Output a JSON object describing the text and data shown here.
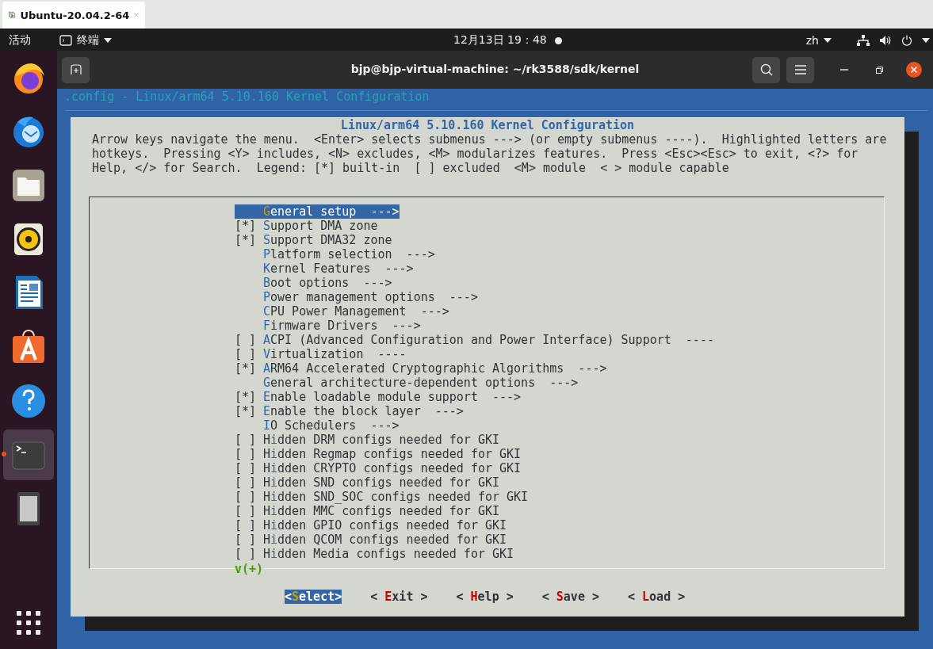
{
  "vm_tab": {
    "title": "Ubuntu-20.04.2-64",
    "selected": true
  },
  "top_bar": {
    "activities": "活动",
    "app_menu": "终端",
    "clock": "12月13日 19：48",
    "input_method": "zh"
  },
  "dock": [
    {
      "kind": "browser",
      "active": false
    },
    {
      "kind": "mail",
      "active": false
    },
    {
      "kind": "files",
      "active": false
    },
    {
      "kind": "music",
      "active": false
    },
    {
      "kind": "writer",
      "active": false
    },
    {
      "kind": "software",
      "active": false
    },
    {
      "kind": "help",
      "active": false
    },
    {
      "kind": "terminal",
      "active": true
    },
    {
      "kind": "phone",
      "active": false
    }
  ],
  "terminal": {
    "title": "bjp@bjp-virtual-machine: ~/rk3588/sdk/kernel",
    "screen_title": ".config - Linux/arm64 5.10.160 Kernel Configuration",
    "dialog": {
      "title": "Linux/arm64 5.10.160 Kernel Configuration",
      "help": "Arrow keys navigate the menu.  <Enter> selects submenus ---> (or empty submenus ----).  Highlighted letters are\nhotkeys.  Pressing <Y> includes, <N> excludes, <M> modularizes features.  Press <Esc><Esc> to exit, <?> for\nHelp, </> for Search.  Legend: [*] built-in  [ ] excluded  <M> module  < > module capable",
      "items": [
        {
          "hotkey": "G",
          "after": "eneral setup  --->",
          "selected": true
        },
        {
          "box": "[*]",
          "hotkey": "S",
          "after": "upport DMA zone",
          "selected": false
        },
        {
          "box": "[*]",
          "hotkey": "S",
          "after": "upport DMA32 zone",
          "selected": false
        },
        {
          "hotkey": "P",
          "after": "latform selection  --->",
          "selected": false
        },
        {
          "hotkey": "K",
          "after": "ernel Features  --->",
          "selected": false
        },
        {
          "hotkey": "B",
          "after": "oot options  --->",
          "selected": false
        },
        {
          "hotkey": "P",
          "after": "ower management options  --->",
          "selected": false
        },
        {
          "hotkey": "C",
          "after": "PU Power Management  --->",
          "selected": false
        },
        {
          "hotkey": "F",
          "after": "irmware Drivers  --->",
          "selected": false
        },
        {
          "box": "[ ]",
          "hotkey": "A",
          "after": "CPI (Advanced Configuration and Power Interface) Support  ----",
          "selected": false
        },
        {
          "box": "[ ]",
          "hotkey": "V",
          "after": "irtualization  ----",
          "selected": false
        },
        {
          "box": "[*]",
          "hotkey": "A",
          "after": "RM64 Accelerated Cryptographic Algorithms  --->",
          "selected": false
        },
        {
          "hotkey": "G",
          "after": "eneral architecture-dependent options  --->",
          "selected": false
        },
        {
          "box": "[*]",
          "hotkey": "E",
          "after": "nable loadable module support  --->",
          "selected": false
        },
        {
          "box": "[*]",
          "hotkey": "E",
          "after": "nable the block layer  --->",
          "selected": false
        },
        {
          "hotkey": "I",
          "after": "O Schedulers  --->",
          "selected": false
        },
        {
          "box": "[ ]",
          "before": "H",
          "hotkey": "i",
          "after": "dden DRM configs needed for GKI",
          "selected": false
        },
        {
          "box": "[ ]",
          "before": "H",
          "hotkey": "i",
          "after": "dden Regmap configs needed for GKI",
          "selected": false
        },
        {
          "box": "[ ]",
          "before": "H",
          "hotkey": "i",
          "after": "dden CRYPTO configs needed for GKI",
          "selected": false
        },
        {
          "box": "[ ]",
          "before": "H",
          "hotkey": "i",
          "after": "dden SND configs needed for GKI",
          "selected": false
        },
        {
          "box": "[ ]",
          "before": "H",
          "hotkey": "i",
          "after": "dden SND_SOC configs needed for GKI",
          "selected": false
        },
        {
          "box": "[ ]",
          "before": "H",
          "hotkey": "i",
          "after": "dden MMC configs needed for GKI",
          "selected": false
        },
        {
          "box": "[ ]",
          "before": "H",
          "hotkey": "i",
          "after": "dden GPIO configs needed for GKI",
          "selected": false
        },
        {
          "box": "[ ]",
          "before": "H",
          "hotkey": "i",
          "after": "dden QCOM configs needed for GKI",
          "selected": false
        },
        {
          "box": "[ ]",
          "before": "H",
          "hotkey": "i",
          "after": "dden Media configs needed for GKI",
          "selected": false
        }
      ],
      "more_indicator": "v(+)",
      "buttons": [
        {
          "before": "<",
          "hotkey": "S",
          "after": "elect>",
          "selected": true
        },
        {
          "before": "< ",
          "hotkey": "E",
          "after": "xit >",
          "selected": false
        },
        {
          "before": "< ",
          "hotkey": "H",
          "after": "elp >",
          "selected": false
        },
        {
          "before": "< ",
          "hotkey": "S",
          "after": "ave >",
          "selected": false
        },
        {
          "before": "< ",
          "hotkey": "L",
          "after": "oad >",
          "selected": false
        }
      ]
    }
  }
}
